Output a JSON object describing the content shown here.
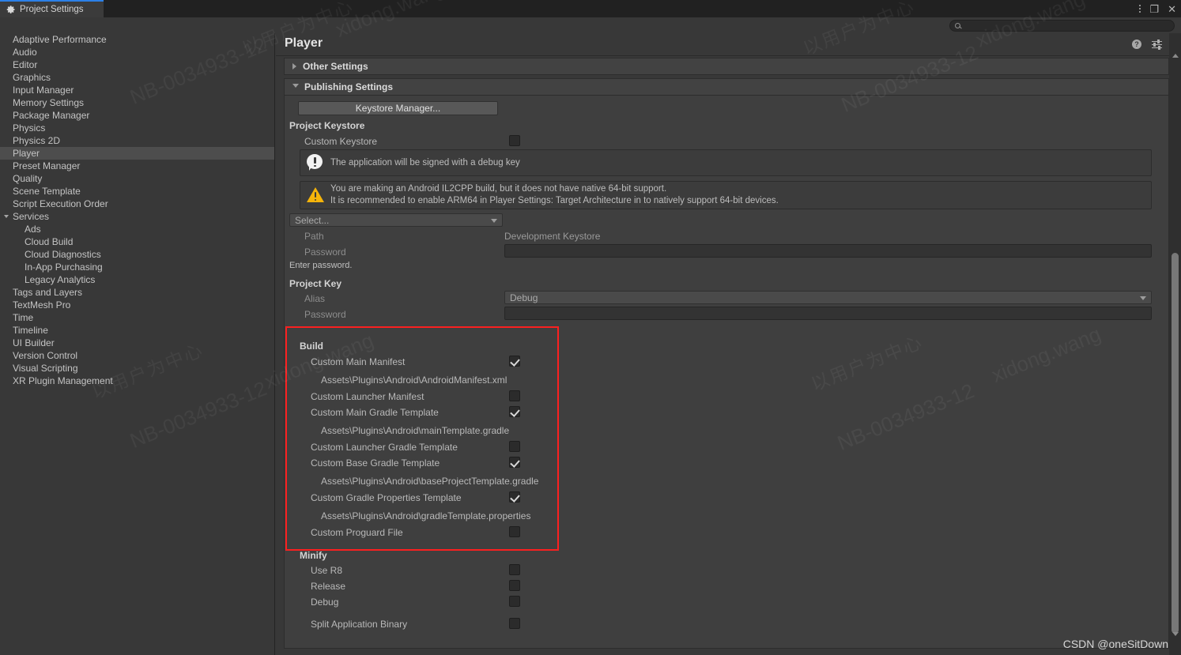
{
  "window": {
    "tab_label": "Project Settings",
    "tab_icon": "gear-icon",
    "controls": {
      "menu": "kebab-icon",
      "maximize": "❐",
      "close": "✕"
    }
  },
  "search": {
    "value": "",
    "placeholder": "",
    "icon": "search-icon"
  },
  "sidebar": {
    "items": [
      {
        "label": "Adaptive Performance",
        "level": 0,
        "selected": false
      },
      {
        "label": "Audio",
        "level": 0,
        "selected": false
      },
      {
        "label": "Editor",
        "level": 0,
        "selected": false
      },
      {
        "label": "Graphics",
        "level": 0,
        "selected": false
      },
      {
        "label": "Input Manager",
        "level": 0,
        "selected": false
      },
      {
        "label": "Memory Settings",
        "level": 0,
        "selected": false
      },
      {
        "label": "Package Manager",
        "level": 0,
        "selected": false
      },
      {
        "label": "Physics",
        "level": 0,
        "selected": false
      },
      {
        "label": "Physics 2D",
        "level": 0,
        "selected": false
      },
      {
        "label": "Player",
        "level": 0,
        "selected": true
      },
      {
        "label": "Preset Manager",
        "level": 0,
        "selected": false
      },
      {
        "label": "Quality",
        "level": 0,
        "selected": false
      },
      {
        "label": "Scene Template",
        "level": 0,
        "selected": false
      },
      {
        "label": "Script Execution Order",
        "level": 0,
        "selected": false
      },
      {
        "label": "Services",
        "level": 0,
        "selected": false,
        "expanded": true
      },
      {
        "label": "Ads",
        "level": 1,
        "selected": false
      },
      {
        "label": "Cloud Build",
        "level": 1,
        "selected": false
      },
      {
        "label": "Cloud Diagnostics",
        "level": 1,
        "selected": false
      },
      {
        "label": "In-App Purchasing",
        "level": 1,
        "selected": false
      },
      {
        "label": "Legacy Analytics",
        "level": 1,
        "selected": false
      },
      {
        "label": "Tags and Layers",
        "level": 0,
        "selected": false
      },
      {
        "label": "TextMesh Pro",
        "level": 0,
        "selected": false
      },
      {
        "label": "Time",
        "level": 0,
        "selected": false
      },
      {
        "label": "Timeline",
        "level": 0,
        "selected": false
      },
      {
        "label": "UI Builder",
        "level": 0,
        "selected": false
      },
      {
        "label": "Version Control",
        "level": 0,
        "selected": false
      },
      {
        "label": "Visual Scripting",
        "level": 0,
        "selected": false
      },
      {
        "label": "XR Plugin Management",
        "level": 0,
        "selected": false
      }
    ]
  },
  "main": {
    "title": "Player",
    "header_icons": {
      "help": "?",
      "preset": "preset-icon",
      "menu": "kebab-icon"
    },
    "foldouts": {
      "other_settings": "Other Settings",
      "publishing_settings": "Publishing Settings"
    },
    "keystore_manager_button": "Keystore Manager...",
    "project_keystore": {
      "section_label": "Project Keystore",
      "custom_keystore_label": "Custom Keystore",
      "custom_keystore_checked": false,
      "info_message": "The application will be signed with a debug key",
      "warning_line1": "You are making an Android IL2CPP build, but it does not have native 64-bit support.",
      "warning_line2": "It is recommended to enable ARM64 in Player Settings: Target Architecture in to natively support 64-bit devices.",
      "select_dropdown": "Select...",
      "path_label": "Path",
      "path_value": "Development Keystore",
      "password_label": "Password",
      "password_value": "",
      "password_hint": "Enter password."
    },
    "project_key": {
      "section_label": "Project Key",
      "alias_label": "Alias",
      "alias_value": "Debug",
      "password_label": "Password",
      "password_value": ""
    },
    "build": {
      "section_label": "Build",
      "rows": [
        {
          "label": "Custom Main Manifest",
          "checked": true,
          "path": "Assets\\Plugins\\Android\\AndroidManifest.xml"
        },
        {
          "label": "Custom Launcher Manifest",
          "checked": false,
          "path": null
        },
        {
          "label": "Custom Main Gradle Template",
          "checked": true,
          "path": "Assets\\Plugins\\Android\\mainTemplate.gradle"
        },
        {
          "label": "Custom Launcher Gradle Template",
          "checked": false,
          "path": null
        },
        {
          "label": "Custom Base Gradle Template",
          "checked": true,
          "path": "Assets\\Plugins\\Android\\baseProjectTemplate.gradle"
        },
        {
          "label": "Custom Gradle Properties Template",
          "checked": true,
          "path": "Assets\\Plugins\\Android\\gradleTemplate.properties"
        },
        {
          "label": "Custom Proguard File",
          "checked": false,
          "path": null
        }
      ]
    },
    "minify": {
      "section_label": "Minify",
      "rows": [
        {
          "label": "Use R8",
          "checked": false
        },
        {
          "label": "Release",
          "checked": false
        },
        {
          "label": "Debug",
          "checked": false
        }
      ]
    },
    "split_application_binary": {
      "label": "Split Application Binary",
      "checked": false
    }
  },
  "highlight": {
    "color": "#fb2020"
  },
  "watermarks": {
    "cn": "以用户为中心",
    "code": "NB-0034933-12",
    "name": "xidong.wang"
  },
  "footer": {
    "credit": "CSDN @oneSitDown"
  },
  "colors": {
    "accent": "#2c80e8",
    "panel_bg": "#3f3f3f",
    "window_bg": "#383838",
    "header_bg": "#424242",
    "selection": "#4d4d4d",
    "warning": "#f5b40a",
    "highlight": "#fb2020"
  }
}
